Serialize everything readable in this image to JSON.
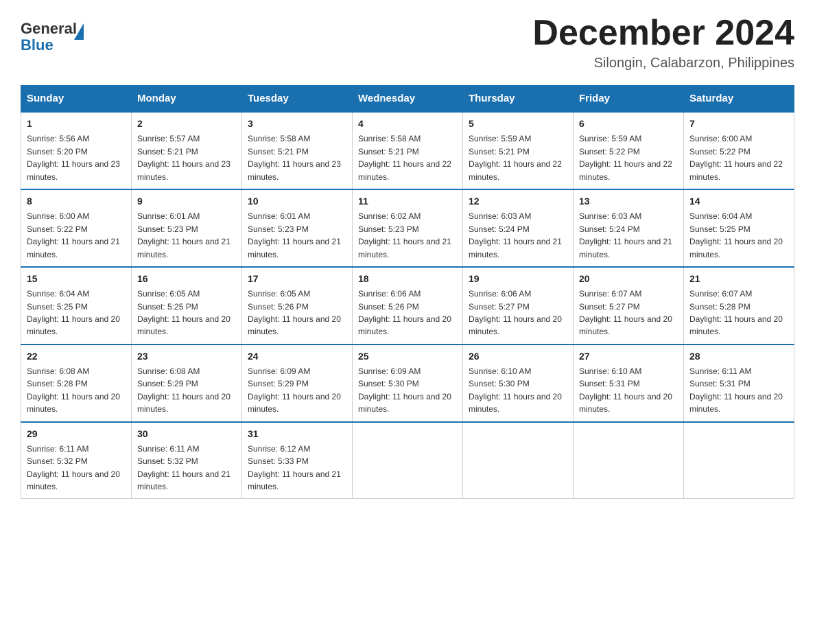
{
  "logo": {
    "general": "General",
    "blue": "Blue"
  },
  "header": {
    "month_year": "December 2024",
    "location": "Silongin, Calabarzon, Philippines"
  },
  "weekdays": [
    "Sunday",
    "Monday",
    "Tuesday",
    "Wednesday",
    "Thursday",
    "Friday",
    "Saturday"
  ],
  "weeks": [
    [
      {
        "day": "1",
        "sunrise": "5:56 AM",
        "sunset": "5:20 PM",
        "daylight": "11 hours and 23 minutes."
      },
      {
        "day": "2",
        "sunrise": "5:57 AM",
        "sunset": "5:21 PM",
        "daylight": "11 hours and 23 minutes."
      },
      {
        "day": "3",
        "sunrise": "5:58 AM",
        "sunset": "5:21 PM",
        "daylight": "11 hours and 23 minutes."
      },
      {
        "day": "4",
        "sunrise": "5:58 AM",
        "sunset": "5:21 PM",
        "daylight": "11 hours and 22 minutes."
      },
      {
        "day": "5",
        "sunrise": "5:59 AM",
        "sunset": "5:21 PM",
        "daylight": "11 hours and 22 minutes."
      },
      {
        "day": "6",
        "sunrise": "5:59 AM",
        "sunset": "5:22 PM",
        "daylight": "11 hours and 22 minutes."
      },
      {
        "day": "7",
        "sunrise": "6:00 AM",
        "sunset": "5:22 PM",
        "daylight": "11 hours and 22 minutes."
      }
    ],
    [
      {
        "day": "8",
        "sunrise": "6:00 AM",
        "sunset": "5:22 PM",
        "daylight": "11 hours and 21 minutes."
      },
      {
        "day": "9",
        "sunrise": "6:01 AM",
        "sunset": "5:23 PM",
        "daylight": "11 hours and 21 minutes."
      },
      {
        "day": "10",
        "sunrise": "6:01 AM",
        "sunset": "5:23 PM",
        "daylight": "11 hours and 21 minutes."
      },
      {
        "day": "11",
        "sunrise": "6:02 AM",
        "sunset": "5:23 PM",
        "daylight": "11 hours and 21 minutes."
      },
      {
        "day": "12",
        "sunrise": "6:03 AM",
        "sunset": "5:24 PM",
        "daylight": "11 hours and 21 minutes."
      },
      {
        "day": "13",
        "sunrise": "6:03 AM",
        "sunset": "5:24 PM",
        "daylight": "11 hours and 21 minutes."
      },
      {
        "day": "14",
        "sunrise": "6:04 AM",
        "sunset": "5:25 PM",
        "daylight": "11 hours and 20 minutes."
      }
    ],
    [
      {
        "day": "15",
        "sunrise": "6:04 AM",
        "sunset": "5:25 PM",
        "daylight": "11 hours and 20 minutes."
      },
      {
        "day": "16",
        "sunrise": "6:05 AM",
        "sunset": "5:25 PM",
        "daylight": "11 hours and 20 minutes."
      },
      {
        "day": "17",
        "sunrise": "6:05 AM",
        "sunset": "5:26 PM",
        "daylight": "11 hours and 20 minutes."
      },
      {
        "day": "18",
        "sunrise": "6:06 AM",
        "sunset": "5:26 PM",
        "daylight": "11 hours and 20 minutes."
      },
      {
        "day": "19",
        "sunrise": "6:06 AM",
        "sunset": "5:27 PM",
        "daylight": "11 hours and 20 minutes."
      },
      {
        "day": "20",
        "sunrise": "6:07 AM",
        "sunset": "5:27 PM",
        "daylight": "11 hours and 20 minutes."
      },
      {
        "day": "21",
        "sunrise": "6:07 AM",
        "sunset": "5:28 PM",
        "daylight": "11 hours and 20 minutes."
      }
    ],
    [
      {
        "day": "22",
        "sunrise": "6:08 AM",
        "sunset": "5:28 PM",
        "daylight": "11 hours and 20 minutes."
      },
      {
        "day": "23",
        "sunrise": "6:08 AM",
        "sunset": "5:29 PM",
        "daylight": "11 hours and 20 minutes."
      },
      {
        "day": "24",
        "sunrise": "6:09 AM",
        "sunset": "5:29 PM",
        "daylight": "11 hours and 20 minutes."
      },
      {
        "day": "25",
        "sunrise": "6:09 AM",
        "sunset": "5:30 PM",
        "daylight": "11 hours and 20 minutes."
      },
      {
        "day": "26",
        "sunrise": "6:10 AM",
        "sunset": "5:30 PM",
        "daylight": "11 hours and 20 minutes."
      },
      {
        "day": "27",
        "sunrise": "6:10 AM",
        "sunset": "5:31 PM",
        "daylight": "11 hours and 20 minutes."
      },
      {
        "day": "28",
        "sunrise": "6:11 AM",
        "sunset": "5:31 PM",
        "daylight": "11 hours and 20 minutes."
      }
    ],
    [
      {
        "day": "29",
        "sunrise": "6:11 AM",
        "sunset": "5:32 PM",
        "daylight": "11 hours and 20 minutes."
      },
      {
        "day": "30",
        "sunrise": "6:11 AM",
        "sunset": "5:32 PM",
        "daylight": "11 hours and 21 minutes."
      },
      {
        "day": "31",
        "sunrise": "6:12 AM",
        "sunset": "5:33 PM",
        "daylight": "11 hours and 21 minutes."
      },
      null,
      null,
      null,
      null
    ]
  ]
}
